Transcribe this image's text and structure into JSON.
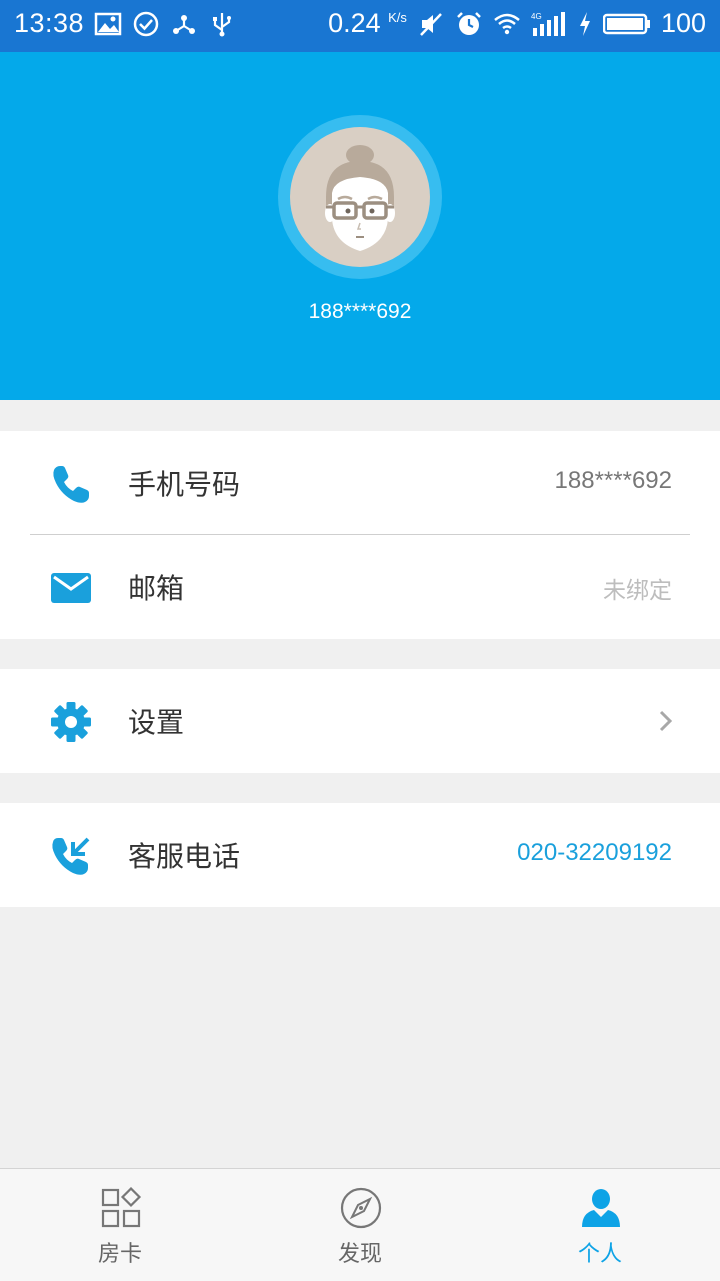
{
  "status_bar": {
    "time": "13:38",
    "speed": "0.24",
    "speed_unit": "K/s",
    "network": "4G",
    "battery": "100"
  },
  "profile": {
    "phone": "188****692"
  },
  "info_rows": [
    {
      "label": "手机号码",
      "value": "188****692",
      "icon": "phone-icon"
    },
    {
      "label": "邮箱",
      "value": "未绑定",
      "icon": "mail-icon"
    }
  ],
  "settings": {
    "label": "设置",
    "icon": "gear-icon"
  },
  "service": {
    "label": "客服电话",
    "value": "020-32209192",
    "icon": "phone-callback-icon"
  },
  "tabs": [
    {
      "label": "房卡",
      "icon": "grid-icon",
      "active": false
    },
    {
      "label": "发现",
      "icon": "compass-icon",
      "active": false
    },
    {
      "label": "个人",
      "icon": "person-icon",
      "active": true
    }
  ],
  "colors": {
    "header": "#04a9ea",
    "status_bar": "#1976d2",
    "accent": "#0ea3e6"
  }
}
